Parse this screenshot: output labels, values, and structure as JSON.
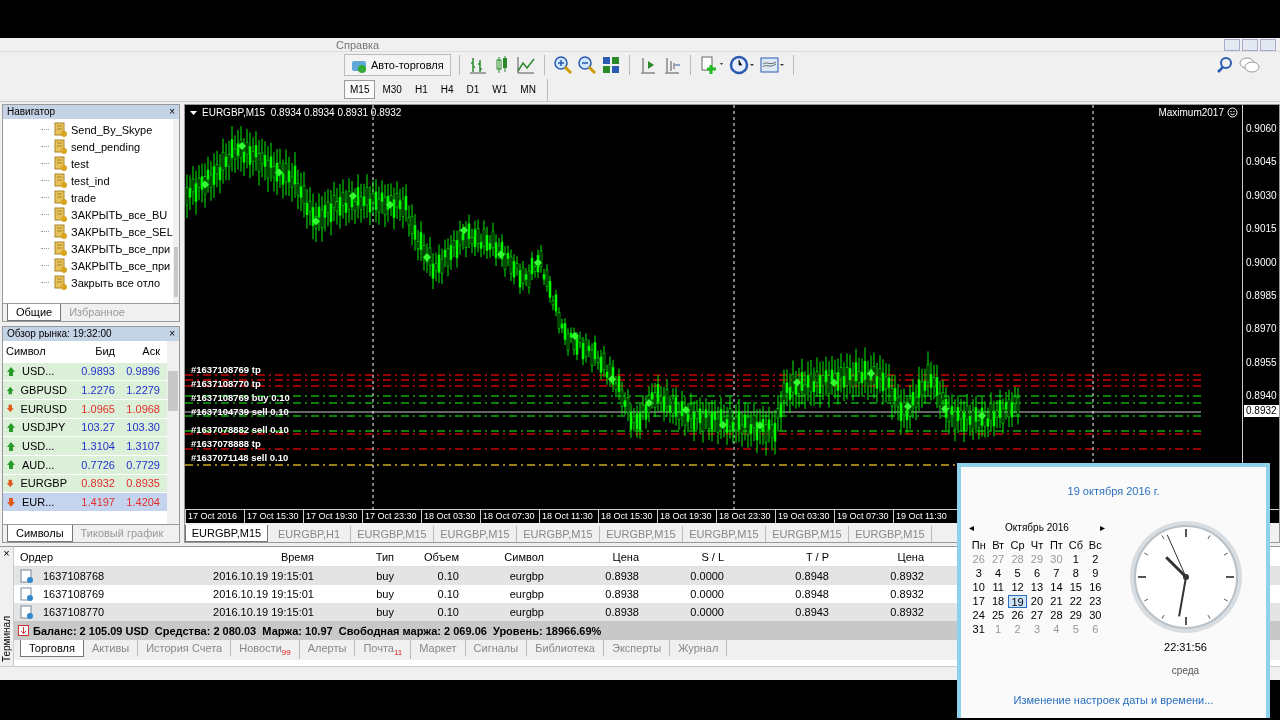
{
  "menu": {
    "items": [
      "Справка"
    ]
  },
  "toolbar": {
    "autotrade_label": "Авто-торговля"
  },
  "timeframes": [
    {
      "label": "M15",
      "selected": true
    },
    {
      "label": "M30",
      "selected": false
    },
    {
      "label": "H1",
      "selected": false
    },
    {
      "label": "H4",
      "selected": false
    },
    {
      "label": "D1",
      "selected": false
    },
    {
      "label": "W1",
      "selected": false
    },
    {
      "label": "MN",
      "selected": false
    }
  ],
  "navigator": {
    "title": "Навигатор",
    "close": "×",
    "items": [
      "Send_By_Skype",
      "send_pending",
      "test",
      "test_ind",
      "trade",
      "ЗАКРЫТЬ_все_BU",
      "ЗАКРЫТЬ_все_SEL",
      "ЗАКРЫТЬ_все_при",
      "ЗАКРЫТЬ_все_при",
      "Закрыть все отло"
    ],
    "tabs": [
      {
        "label": "Общие",
        "selected": true
      },
      {
        "label": "Избранное",
        "selected": false
      }
    ]
  },
  "market_watch": {
    "title": "Обзор рынка: 19:32:00",
    "close": "×",
    "columns": [
      "Символ",
      "Бид",
      "Аск"
    ],
    "rows": [
      {
        "symbol": "USD...",
        "bid": "0.9893",
        "ask": "0.9896",
        "rising": true,
        "selected": false
      },
      {
        "symbol": "GBPUSD",
        "bid": "1.2276",
        "ask": "1.2279",
        "rising": true,
        "selected": false
      },
      {
        "symbol": "EURUSD",
        "bid": "1.0965",
        "ask": "1.0968",
        "rising": false,
        "selected": false
      },
      {
        "symbol": "USDJPY",
        "bid": "103.27",
        "ask": "103.30",
        "rising": true,
        "selected": false
      },
      {
        "symbol": "USD...",
        "bid": "1.3104",
        "ask": "1.3107",
        "rising": true,
        "selected": false
      },
      {
        "symbol": "AUD...",
        "bid": "0.7726",
        "ask": "0.7729",
        "rising": true,
        "selected": false
      },
      {
        "symbol": "EURGBP",
        "bid": "0.8932",
        "ask": "0.8935",
        "rising": false,
        "selected": false
      },
      {
        "symbol": "EUR...",
        "bid": "1.4197",
        "ask": "1.4204",
        "rising": false,
        "selected": true
      }
    ],
    "tabs": [
      {
        "label": "Символы",
        "selected": true
      },
      {
        "label": "Тиковый график",
        "selected": false
      }
    ]
  },
  "chart": {
    "header": "EURGBP,M15  0.8934 0.8934 0.8931 0.8932",
    "expert": "Maximum2017",
    "price_labels": [
      "0.9060",
      "0.9045",
      "0.9030",
      "0.9015",
      "0.9000",
      "0.8985",
      "0.8970",
      "0.8955",
      "0.8940"
    ],
    "current_price": "0.8932",
    "time_labels": [
      "17 Oct 2016",
      "17 Oct 15:30",
      "17 Oct 19:30",
      "17 Oct 23:30",
      "18 Oct 03:30",
      "18 Oct 07:30",
      "18 Oct 11:30",
      "18 Oct 15:30",
      "18 Oct 19:30",
      "18 Oct 23:30",
      "19 Oct 03:30",
      "19 Oct 07:30",
      "19 Oct 11:30"
    ],
    "order_labels": [
      "#1637108769 tp",
      "#1637108770 tp",
      "#1637108769 buy 0.10",
      "#1637104739 sell 0.10",
      "#1637078882 sell 0.10",
      "#1637078888 tp",
      "#1637071148 sell 0.10"
    ]
  },
  "chart_tabs": [
    {
      "label": "EURGBP,M15",
      "selected": true
    },
    {
      "label": "EURGBP,H1",
      "selected": false
    },
    {
      "label": "EURGBP,M15",
      "selected": false
    },
    {
      "label": "EURGBP,M15",
      "selected": false
    },
    {
      "label": "EURGBP,M15",
      "selected": false
    },
    {
      "label": "EURGBP,M15",
      "selected": false
    },
    {
      "label": "EURGBP,M15",
      "selected": false
    },
    {
      "label": "EURGBP,M15",
      "selected": false
    },
    {
      "label": "EURGBP,M15",
      "selected": false
    }
  ],
  "terminal": {
    "side_label": "Терминал",
    "close": "×",
    "columns": [
      "Ордер",
      "Время",
      "Тип",
      "Объем",
      "Символ",
      "Цена",
      "S / L",
      "T / P",
      "Цена"
    ],
    "rows": [
      [
        "1637108768",
        "2016.10.19 19:15:01",
        "buy",
        "0.10",
        "eurgbp",
        "0.8938",
        "0.0000",
        "0.8948",
        "0.8932"
      ],
      [
        "1637108769",
        "2016.10.19 19:15:01",
        "buy",
        "0.10",
        "eurgbp",
        "0.8938",
        "0.0000",
        "0.8948",
        "0.8932"
      ],
      [
        "1637108770",
        "2016.10.19 19:15:01",
        "buy",
        "0.10",
        "eurgbp",
        "0.8938",
        "0.0000",
        "0.8943",
        "0.8932"
      ]
    ],
    "balance": "Баланс: 2 105.09 USD  Средства: 2 080.03  Маржа: 10.97  Свободная маржа: 2 069.06  Уровень: 18966.69%",
    "tabs": [
      {
        "label": "Торговля",
        "selected": true
      },
      {
        "label": "Активы",
        "selected": false
      },
      {
        "label": "История Счета",
        "selected": false
      },
      {
        "label": "Новости",
        "badge": "99",
        "selected": false
      },
      {
        "label": "Алерты",
        "selected": false
      },
      {
        "label": "Почта",
        "badge": "11",
        "selected": false
      },
      {
        "label": "Маркет",
        "selected": false
      },
      {
        "label": "Сигналы",
        "selected": false
      },
      {
        "label": "Библиотека",
        "selected": false
      },
      {
        "label": "Эксперты",
        "selected": false
      },
      {
        "label": "Журнал",
        "selected": false
      }
    ]
  },
  "calendar": {
    "date_title": "19 октября 2016 г.",
    "prev": "◂",
    "next": "▸",
    "month": "Октябрь 2016",
    "weekdays": [
      "Пн",
      "Вт",
      "Ср",
      "Чт",
      "Пт",
      "Сб",
      "Вс"
    ],
    "days": [
      {
        "label": "26",
        "other_month": true,
        "selected": false
      },
      {
        "label": "27",
        "other_month": true,
        "selected": false
      },
      {
        "label": "28",
        "other_month": true,
        "selected": false
      },
      {
        "label": "29",
        "other_month": true,
        "selected": false
      },
      {
        "label": "30",
        "other_month": true,
        "selected": false
      },
      {
        "label": "1",
        "other_month": false,
        "selected": false
      },
      {
        "label": "2",
        "other_month": false,
        "selected": false
      },
      {
        "label": "3",
        "other_month": false,
        "selected": false
      },
      {
        "label": "4",
        "other_month": false,
        "selected": false
      },
      {
        "label": "5",
        "other_month": false,
        "selected": false
      },
      {
        "label": "6",
        "other_month": false,
        "selected": false
      },
      {
        "label": "7",
        "other_month": false,
        "selected": false
      },
      {
        "label": "8",
        "other_month": false,
        "selected": false
      },
      {
        "label": "9",
        "other_month": false,
        "selected": false
      },
      {
        "label": "10",
        "other_month": false,
        "selected": false
      },
      {
        "label": "11",
        "other_month": false,
        "selected": false
      },
      {
        "label": "12",
        "other_month": false,
        "selected": false
      },
      {
        "label": "13",
        "other_month": false,
        "selected": false
      },
      {
        "label": "14",
        "other_month": false,
        "selected": false
      },
      {
        "label": "15",
        "other_month": false,
        "selected": false
      },
      {
        "label": "16",
        "other_month": false,
        "selected": false
      },
      {
        "label": "17",
        "other_month": false,
        "selected": false
      },
      {
        "label": "18",
        "other_month": false,
        "selected": false
      },
      {
        "label": "19",
        "other_month": false,
        "selected": true
      },
      {
        "label": "20",
        "other_month": false,
        "selected": false
      },
      {
        "label": "21",
        "other_month": false,
        "selected": false
      },
      {
        "label": "22",
        "other_month": false,
        "selected": false
      },
      {
        "label": "23",
        "other_month": false,
        "selected": false
      },
      {
        "label": "24",
        "other_month": false,
        "selected": false
      },
      {
        "label": "25",
        "other_month": false,
        "selected": false
      },
      {
        "label": "26",
        "other_month": false,
        "selected": false
      },
      {
        "label": "27",
        "other_month": false,
        "selected": false
      },
      {
        "label": "28",
        "other_month": false,
        "selected": false
      },
      {
        "label": "29",
        "other_month": false,
        "selected": false
      },
      {
        "label": "30",
        "other_month": false,
        "selected": false
      },
      {
        "label": "31",
        "other_month": false,
        "selected": false
      },
      {
        "label": "1",
        "other_month": true,
        "selected": false
      },
      {
        "label": "2",
        "other_month": true,
        "selected": false
      },
      {
        "label": "3",
        "other_month": true,
        "selected": false
      },
      {
        "label": "4",
        "other_month": true,
        "selected": false
      },
      {
        "label": "5",
        "other_month": true,
        "selected": false
      },
      {
        "label": "6",
        "other_month": true,
        "selected": false
      }
    ],
    "time": "22:31:56",
    "weekday": "среда",
    "settings_link": "Изменение настроек даты и времени..."
  }
}
